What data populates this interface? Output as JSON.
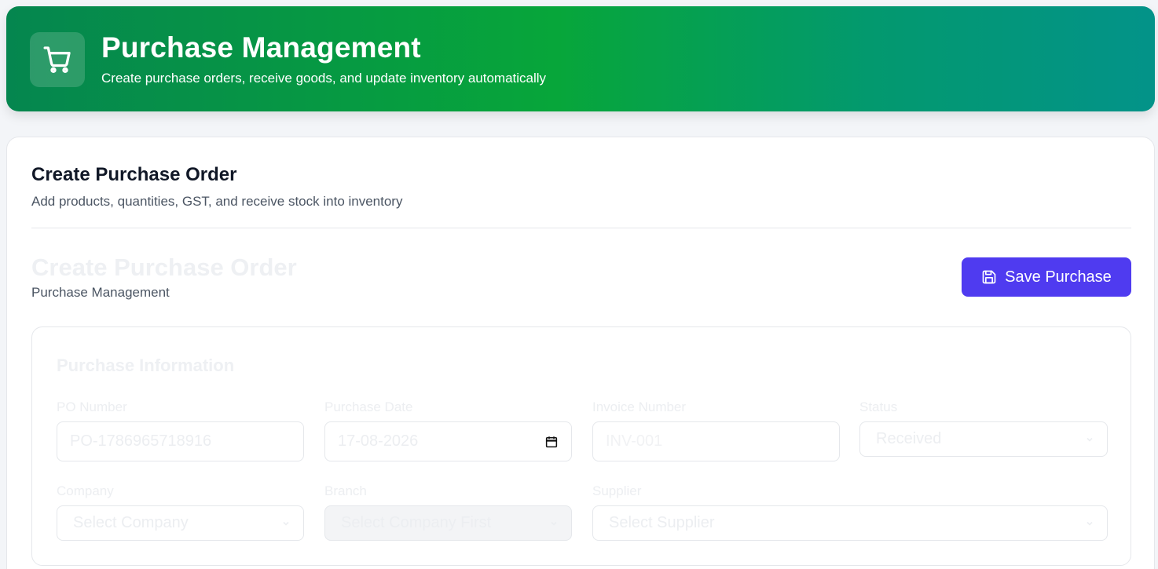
{
  "header": {
    "title": "Purchase Management",
    "subtitle": "Create purchase orders, receive goods, and update inventory automatically",
    "icon": "cart-icon"
  },
  "card": {
    "title": "Create Purchase Order",
    "subtitle": "Add products, quantities, GST, and receive stock into inventory"
  },
  "form_header": {
    "title": "Create Purchase Order",
    "subtitle": "Purchase Management",
    "save_label": "Save Purchase",
    "save_icon": "save-icon",
    "accent_color": "#4f3bf0"
  },
  "purchase_info": {
    "title": "Purchase Information",
    "po_number": {
      "label": "PO Number",
      "value": "PO-1786965718916"
    },
    "purchase_date": {
      "label": "Purchase Date",
      "value": "17-08-2026"
    },
    "invoice_number": {
      "label": "Invoice Number",
      "placeholder": "INV-001"
    },
    "status": {
      "label": "Status",
      "selected": "Received"
    },
    "company": {
      "label": "Company",
      "selected": "Select Company"
    },
    "branch": {
      "label": "Branch",
      "selected": "Select Company First"
    },
    "supplier": {
      "label": "Supplier",
      "selected": "Select Supplier"
    }
  }
}
